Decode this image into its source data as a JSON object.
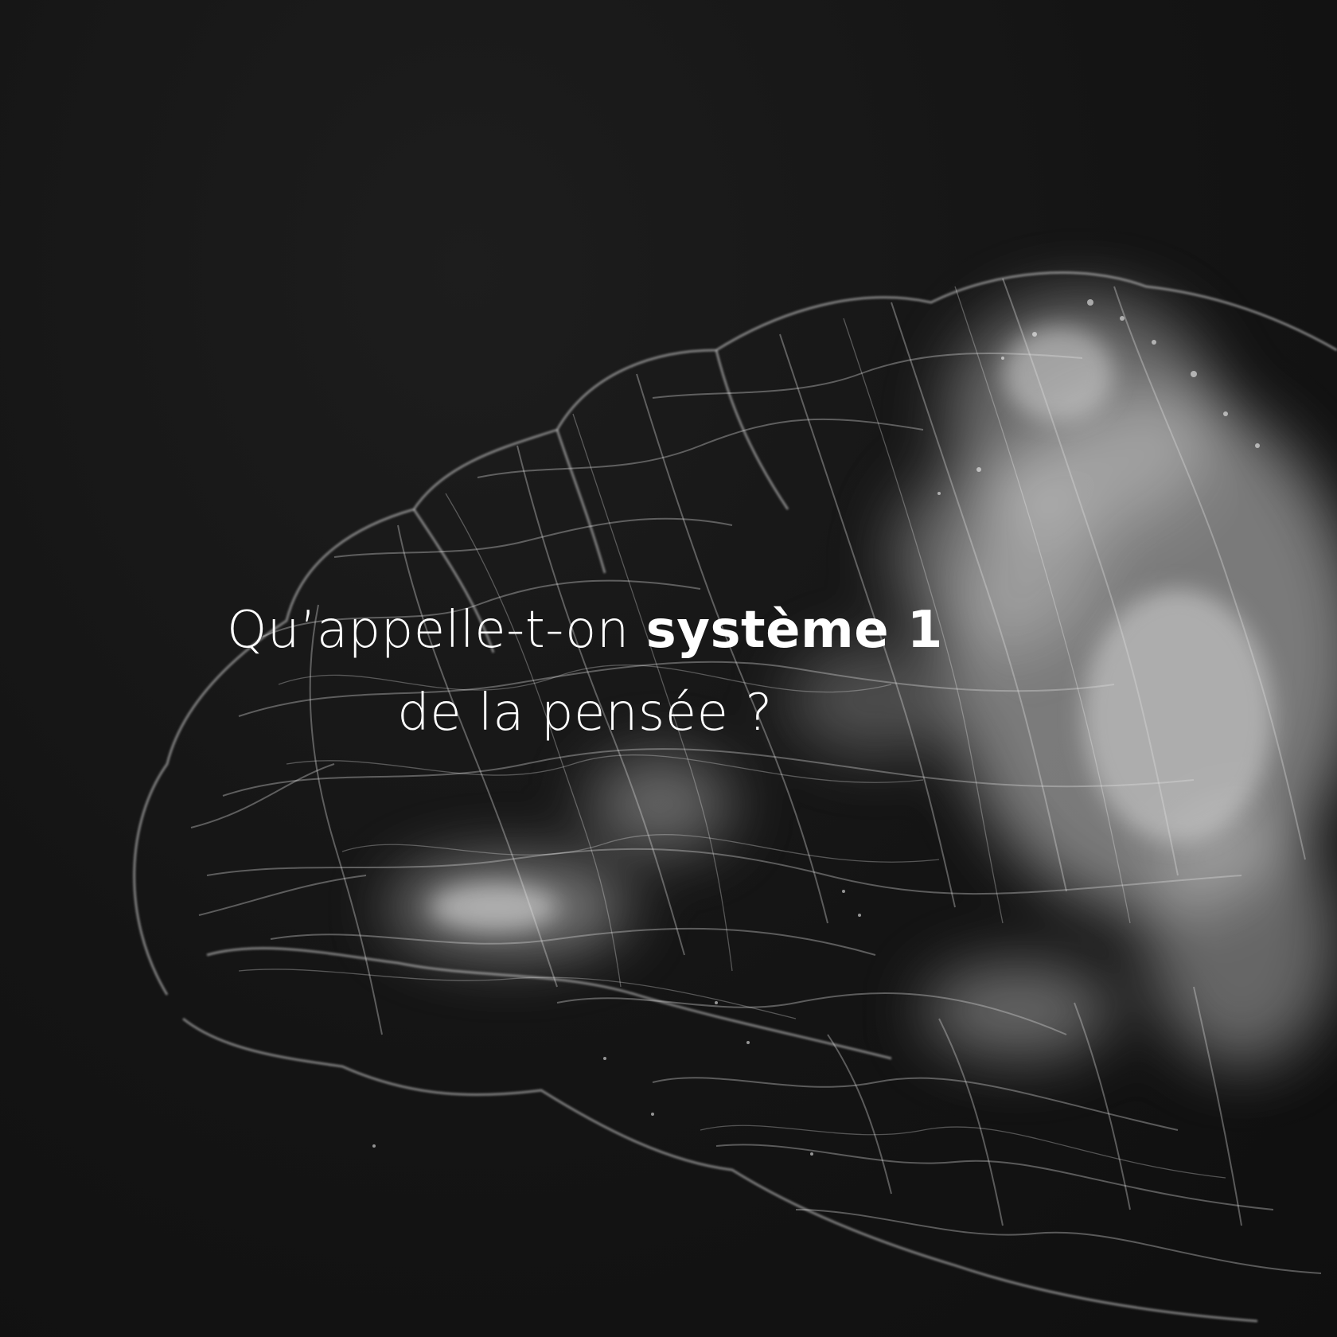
{
  "caption": {
    "line1_prefix": "Qu’appelle-t-on",
    "line1_emphasis": "système 1",
    "line2": "de la pensée ?"
  },
  "colors": {
    "background": "#141414",
    "text": "#ffffff",
    "brain_glow": "#d9d9d9"
  }
}
